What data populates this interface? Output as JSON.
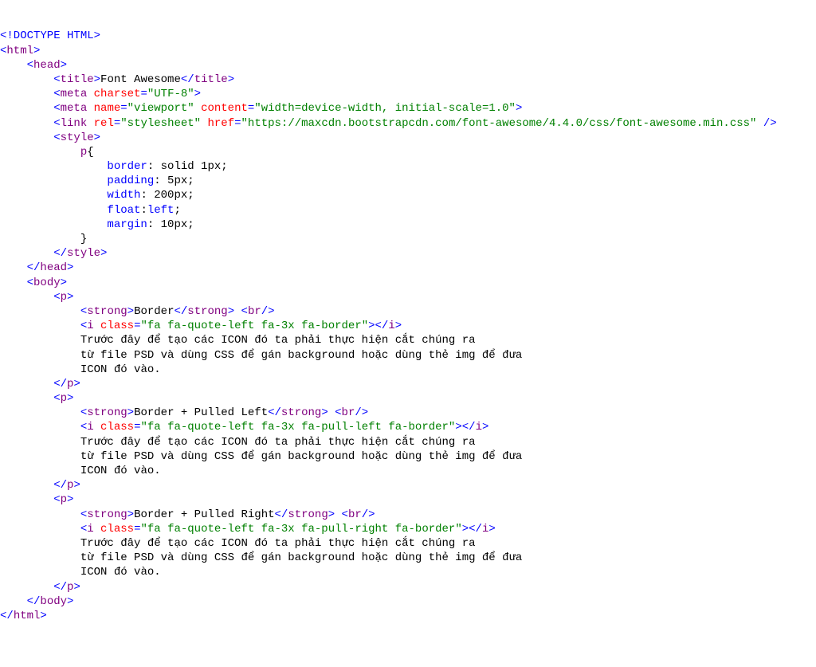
{
  "doctype": "<!DOCTYPE HTML>",
  "html_open": "<",
  "html_tag": "html",
  "html_close_b": ">",
  "head_tag": "head",
  "title_tag": "title",
  "title_text": "Font Awesome",
  "meta_tag": "meta",
  "charset_attr": "charset",
  "charset_val": "\"UTF-8\"",
  "name_attr": "name",
  "viewport_val": "\"viewport\"",
  "content_attr": "content",
  "content_val": "\"width=device-width, initial-scale=1.0\"",
  "link_tag": "link",
  "rel_attr": "rel",
  "stylesheet_val": "\"stylesheet\"",
  "href_attr": "href",
  "href_val": "\"https://maxcdn.bootstrapcdn.com/font-awesome/4.4.0/css/font-awesome.min.css\"",
  "style_tag": "style",
  "css_sel": "p",
  "css_b": "border",
  "css_bv": ": solid 1px;",
  "css_p": "padding",
  "css_pv": ": 5px;",
  "css_w": "width",
  "css_wv": ": 200px;",
  "css_f": "float",
  "css_fv": "left",
  "css_m": "margin",
  "css_mv": ": 10px;",
  "body_tag": "body",
  "p_tag": "p",
  "strong_tag": "strong",
  "border_txt": "Border",
  "br_tag": "br",
  "i_tag": "i",
  "class_attr": "class",
  "i_class1": "\"fa fa-quote-left fa-3x fa-border\"",
  "para_txt1": "Trước đây để tạo các ICON đó ta phải thực hiện cắt chúng ra",
  "para_txt2": "từ file PSD và dùng CSS để gán background hoặc dùng thẻ img để đưa",
  "para_txt3": "ICON đó vào.",
  "border_pl": "Border + Pulled Left",
  "i_class2": "\"fa fa-quote-left fa-3x fa-pull-left fa-border\"",
  "border_pr": "Border + Pulled Right",
  "i_class3": "\"fa fa-quote-left fa-3x fa-pull-right fa-border\""
}
